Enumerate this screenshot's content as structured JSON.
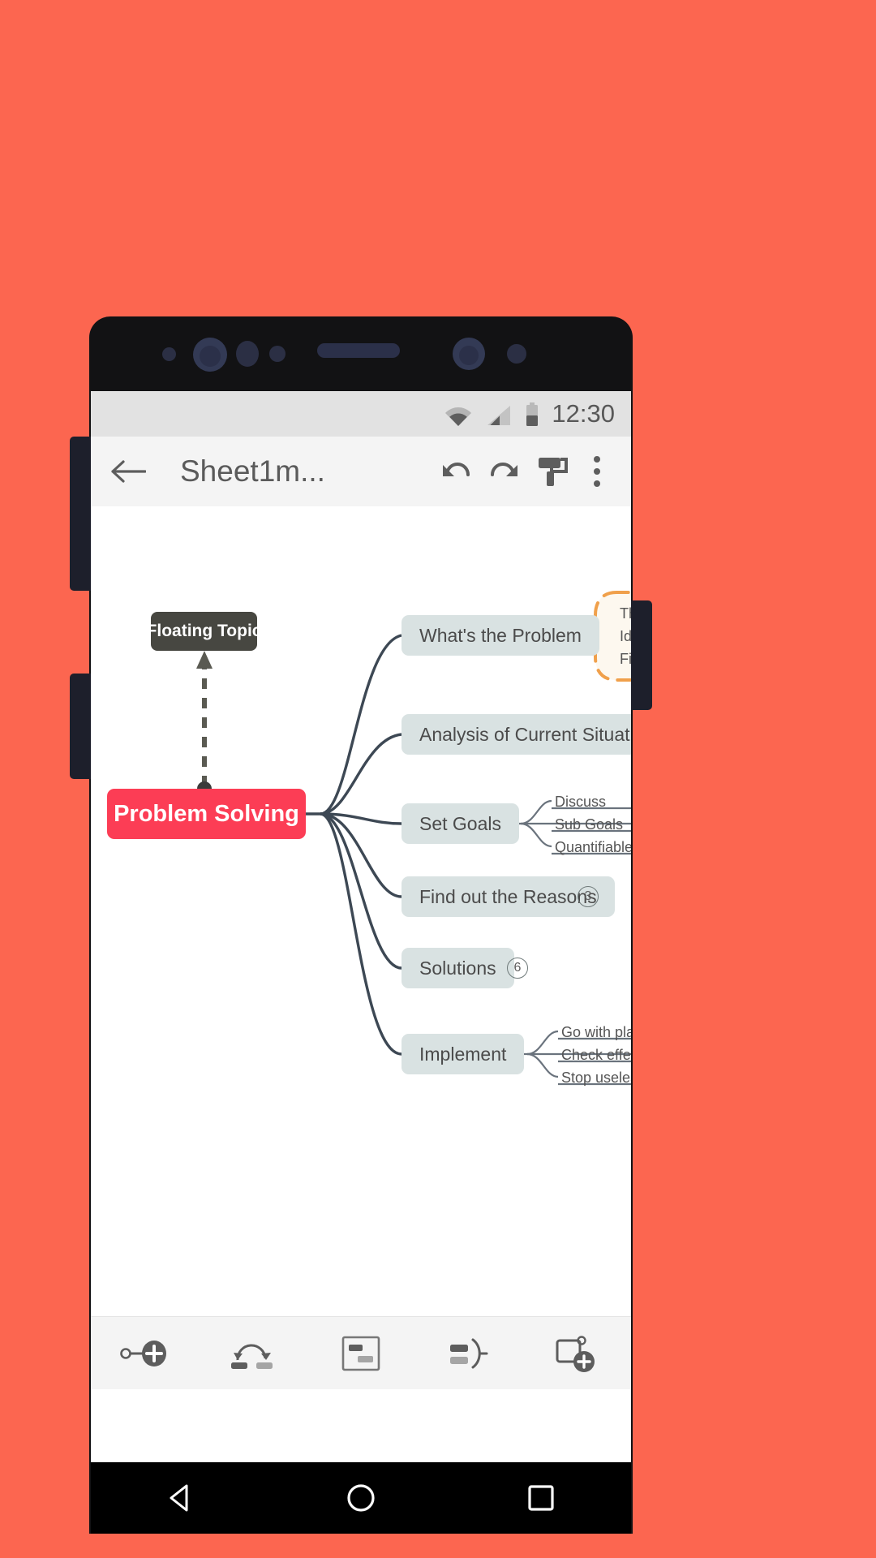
{
  "theme": {
    "page_background": "#fc6650",
    "phone_body": "#121214",
    "status_bar_bg": "#e2e2e2",
    "toolbar_bg": "#f4f4f4",
    "canvas_bg": "#ffffff",
    "central_node_color": "#fc3d55",
    "floating_node_color": "#474741",
    "branch_node_color": "#d9e2e2",
    "boundary_color": "#f0a04b",
    "wire_color": "#3d4854"
  },
  "status_bar": {
    "time": "12:30",
    "icons": [
      "wifi-icon",
      "cellular-signal-icon",
      "battery-icon"
    ]
  },
  "app_toolbar": {
    "back_icon": "back-arrow-icon",
    "title": "Sheet1m...",
    "undo_icon": "undo-icon",
    "redo_icon": "redo-icon",
    "style_icon": "paint-roller-icon",
    "overflow_icon": "overflow-menu-icon"
  },
  "mindmap": {
    "central_topic": "Problem Solving",
    "floating_topic": "Floating Topic",
    "branches": [
      {
        "label": "What's the Problem",
        "children": [
          "Th",
          "Ide",
          "Fir"
        ],
        "boundary": true,
        "badge": null
      },
      {
        "label": "Analysis of Current Situation",
        "children": [],
        "boundary": false,
        "badge": null
      },
      {
        "label": "Set Goals",
        "children": [
          "Discuss",
          "Sub Goals",
          "Quantifiable targe"
        ],
        "boundary": false,
        "badge": null
      },
      {
        "label": "Find out the Reasons",
        "children": [],
        "boundary": false,
        "badge": "3"
      },
      {
        "label": "Solutions",
        "children": [],
        "boundary": false,
        "badge": "6"
      },
      {
        "label": "Implement",
        "children": [
          "Go with plans",
          "Check effect of",
          "Stop useless so"
        ],
        "boundary": false,
        "badge": null
      }
    ]
  },
  "bottom_toolbar": {
    "items": [
      {
        "name": "add-subtopic-icon",
        "label": "Add Subtopic"
      },
      {
        "name": "add-relationship-icon",
        "label": "Relationship"
      },
      {
        "name": "add-boundary-icon",
        "label": "Boundary"
      },
      {
        "name": "add-summary-icon",
        "label": "Summary"
      },
      {
        "name": "add-floating-topic-icon",
        "label": "Floating Topic"
      }
    ]
  },
  "nav_bar": {
    "back": "nav-back-icon",
    "home": "nav-home-icon",
    "recents": "nav-recents-icon"
  }
}
